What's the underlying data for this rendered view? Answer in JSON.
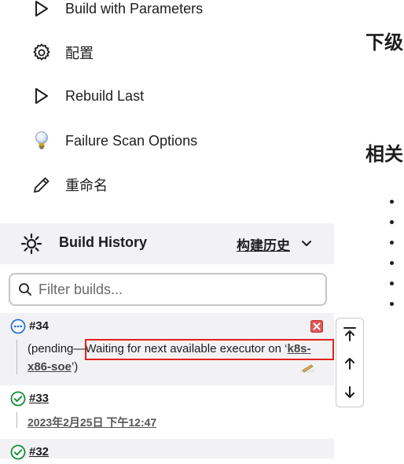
{
  "tasks": [
    {
      "label": "Build with Parameters",
      "icon": "play-outline-icon"
    },
    {
      "label": "配置",
      "icon": "gear-icon"
    },
    {
      "label": "Rebuild Last",
      "icon": "play-outline-icon"
    },
    {
      "label": "Failure Scan Options",
      "icon": "lightbulb-icon"
    },
    {
      "label": "重命名",
      "icon": "pencil-icon"
    }
  ],
  "right_panel": {
    "heading1": "下级",
    "heading2": "相关"
  },
  "build_history": {
    "title": "Build History",
    "trend_label": "构建历史",
    "filter_placeholder": "Filter builds...",
    "builds": [
      {
        "number": "#34",
        "status": "pending",
        "pending_prefix": "(pending—",
        "pending_message": "Waiting for next available executor on ‘",
        "executor_part1": "k8s-",
        "executor_part2": "x86-soe",
        "pending_suffix": "’)"
      },
      {
        "number": "#33",
        "status": "success",
        "date": "2023年2月25日 下午12:47"
      },
      {
        "number": "#32",
        "status": "success"
      }
    ]
  },
  "colors": {
    "success": "#138a36",
    "pending": "#2a6fd6",
    "highlight": "#e0231c",
    "cancel": "#e05656",
    "panel_bg": "#f2f2f4"
  }
}
